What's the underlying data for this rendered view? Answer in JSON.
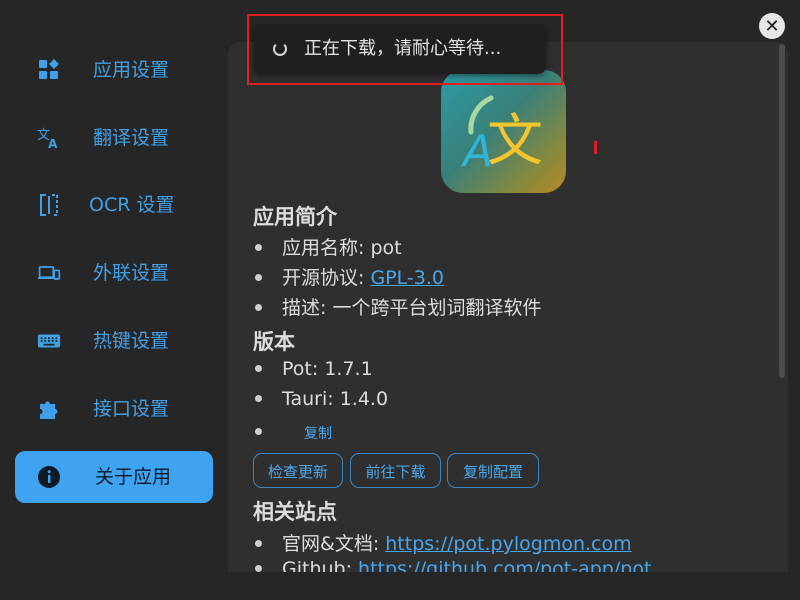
{
  "sidebar": {
    "items": [
      {
        "label": "应用设置",
        "icon": "app-settings-icon"
      },
      {
        "label": "翻译设置",
        "icon": "translate-icon"
      },
      {
        "label": "OCR 设置",
        "icon": "ocr-scan-icon"
      },
      {
        "label": "外联设置",
        "icon": "devices-icon"
      },
      {
        "label": "热键设置",
        "icon": "keyboard-icon"
      },
      {
        "label": "接口设置",
        "icon": "puzzle-icon"
      },
      {
        "label": "关于应用",
        "icon": "info-icon",
        "active": true
      }
    ]
  },
  "toast": {
    "message": "正在下载，请耐心等待..."
  },
  "about": {
    "app_icon_text": {
      "a": "A",
      "wen": "文"
    },
    "intro_heading": "应用简介",
    "name_label": "应用名称:",
    "name_value": "pot",
    "license_label": "开源协议:",
    "license_value": "GPL-3.0",
    "desc_label": "描述:",
    "desc_value": "一个跨平台划词翻译软件",
    "version_heading": "版本",
    "pot_label": "Pot:",
    "pot_value": "1.7.1",
    "tauri_label": "Tauri:",
    "tauri_value": "1.4.0",
    "copy_label": "复制",
    "buttons": {
      "check_update": "检查更新",
      "goto_download": "前往下载",
      "copy_config": "复制配置"
    },
    "sites_heading": "相关站点",
    "website_label": "官网&文档:",
    "website_value": "https://pot.pylogmon.com",
    "github_label": "Github:",
    "github_value": "https://github.com/pot-app/pot"
  },
  "colors": {
    "accent": "#3da3f2",
    "link": "#47a7ee",
    "background": "#262626",
    "panel": "#2f2f2f",
    "highlight": "#e02020"
  }
}
